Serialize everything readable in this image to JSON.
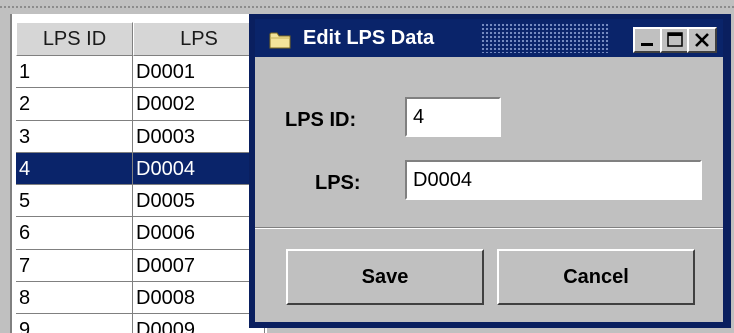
{
  "table": {
    "headers": [
      "LPS ID",
      "LPS"
    ],
    "rows": [
      [
        "1",
        "D0001"
      ],
      [
        "2",
        "D0002"
      ],
      [
        "3",
        "D0003"
      ],
      [
        "4",
        "D0004"
      ],
      [
        "5",
        "D0005"
      ],
      [
        "6",
        "D0006"
      ],
      [
        "7",
        "D0007"
      ],
      [
        "8",
        "D0008"
      ],
      [
        "9",
        "D0009"
      ]
    ],
    "selected_row": 4
  },
  "dialog": {
    "title": "Edit LPS Data",
    "title_icon": "folder-icon",
    "controls": [
      "minimize-icon",
      "maximize-icon",
      "close-icon"
    ],
    "fields": {
      "id_label": "LPS ID:",
      "id_value": "4",
      "lps_label": "LPS:",
      "lps_value": "D0004"
    },
    "buttons": {
      "save": "Save",
      "cancel": "Cancel"
    }
  },
  "colors": {
    "selection": "#0a246a",
    "titlebar": "#0a246a",
    "window_bg": "#c0c0c0"
  }
}
